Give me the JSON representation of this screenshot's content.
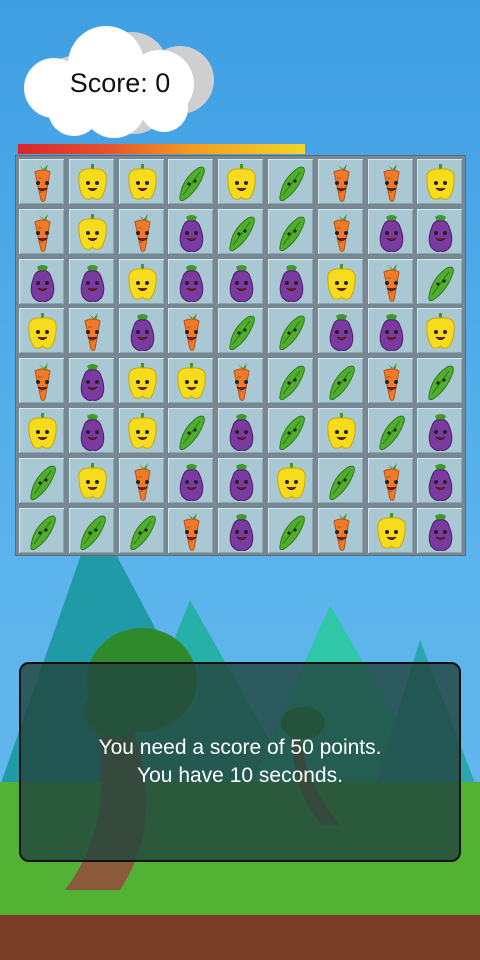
{
  "hud": {
    "score_label": "Score: 0",
    "timer_progress": 0.64,
    "timer_colors": [
      "#d6262a",
      "#f59a1c",
      "#f2d52c"
    ]
  },
  "board": {
    "rows": 8,
    "cols": 9,
    "grid": [
      [
        "carrot",
        "pepper",
        "pepper",
        "pea",
        "pepper",
        "pea",
        "carrot",
        "carrot",
        "pepper"
      ],
      [
        "carrot",
        "pepper",
        "carrot",
        "eggplant",
        "pea",
        "pea",
        "carrot",
        "eggplant",
        "eggplant"
      ],
      [
        "eggplant",
        "eggplant",
        "pepper",
        "eggplant",
        "eggplant",
        "eggplant",
        "pepper",
        "carrot",
        "pea"
      ],
      [
        "pepper",
        "carrot",
        "eggplant",
        "carrot",
        "pea",
        "pea",
        "eggplant",
        "eggplant",
        "pepper"
      ],
      [
        "carrot",
        "eggplant",
        "pepper",
        "pepper",
        "carrot",
        "pea",
        "pea",
        "carrot",
        "pea"
      ],
      [
        "pepper",
        "eggplant",
        "pepper",
        "pea",
        "eggplant",
        "pea",
        "pepper",
        "pea",
        "eggplant"
      ],
      [
        "pea",
        "pepper",
        "carrot",
        "eggplant",
        "eggplant",
        "pepper",
        "pea",
        "carrot",
        "eggplant"
      ],
      [
        "pea",
        "pea",
        "pea",
        "carrot",
        "eggplant",
        "pea",
        "carrot",
        "pepper",
        "eggplant"
      ]
    ],
    "piece_colors": {
      "carrot": "#f07a2a",
      "pepper": "#f7dc1e",
      "pea": "#4fae2c",
      "eggplant": "#7a3aa0"
    }
  },
  "dialog": {
    "line1": "You need a score of 50 points.",
    "line2": "You have 10 seconds."
  },
  "colors": {
    "mountain_dark": "#1f9aa6",
    "mountain_light": "#2fc7a8",
    "grass": "#52b233",
    "ground": "#7a3d26",
    "tree_top": "#2e8a2a",
    "tree_trunk": "#8a5a3a"
  }
}
